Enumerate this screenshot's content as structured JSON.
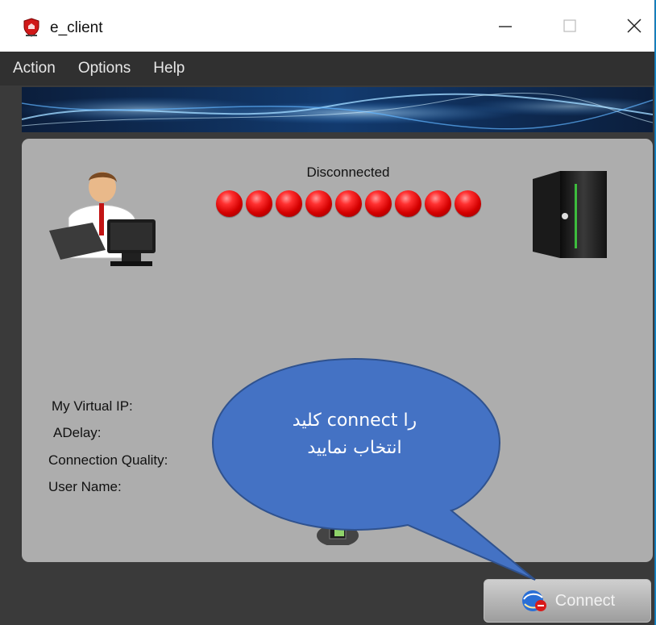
{
  "window": {
    "title": "e_client"
  },
  "menu": {
    "items": [
      "Action",
      "Options",
      "Help"
    ]
  },
  "status": {
    "text": "Disconnected",
    "indicator_count": 9,
    "indicator_color": "#e00000"
  },
  "info": {
    "virtual_ip_label": "My Virtual IP:",
    "delay_label": "ADelay:",
    "quality_label": "Connection Quality:",
    "username_label": "User Name:"
  },
  "connect_button": {
    "label": "Connect"
  },
  "callout": {
    "line1": "کلید  connect را",
    "line2": "انتخاب نمایید",
    "color": "#4472c4"
  },
  "icons": [
    "app-shield-icon",
    "minimize-icon",
    "maximize-icon",
    "close-icon",
    "user-computer-icon",
    "server-icon",
    "network-card-icon",
    "connect-globe-icon"
  ]
}
